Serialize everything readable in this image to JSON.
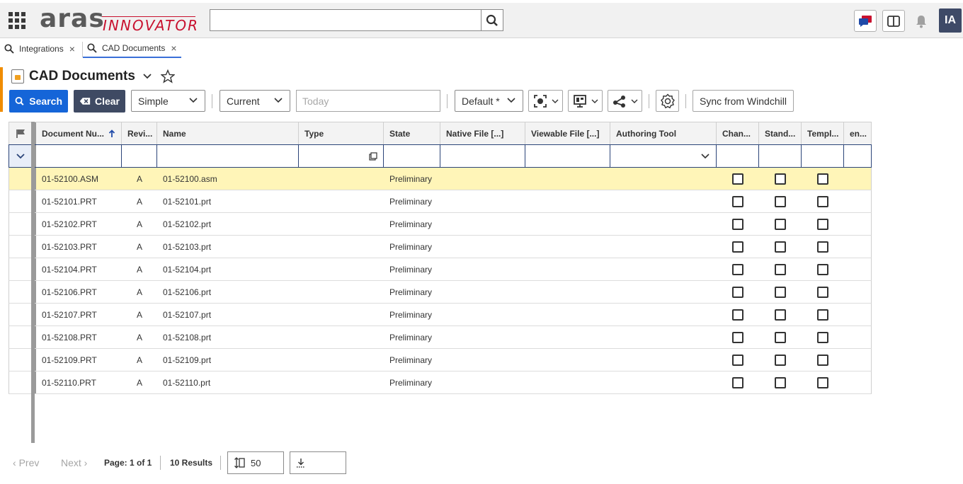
{
  "header": {
    "logo_main": "aras",
    "logo_sub": "INNOVATOR",
    "search_placeholder": "",
    "avatar_initials": "IA"
  },
  "tabs": [
    {
      "label": "Integrations",
      "active": false
    },
    {
      "label": "CAD Documents",
      "active": true
    }
  ],
  "page": {
    "title": "CAD Documents"
  },
  "toolbar": {
    "search_label": "Search",
    "clear_label": "Clear",
    "mode_select": "Simple",
    "version_select": "Current",
    "date_placeholder": "Today",
    "view_select": "Default *",
    "sync_label": "Sync from Windchill"
  },
  "grid": {
    "columns": [
      "Document Nu...",
      "Revi...",
      "Name",
      "Type",
      "State",
      "Native File [...]",
      "Viewable File [...]",
      "Authoring Tool",
      "Chan...",
      "Stand...",
      "Templ...",
      "en..."
    ],
    "rows": [
      {
        "doc": "01-52100.ASM",
        "rev": "A",
        "name": "01-52100.asm",
        "state": "Preliminary"
      },
      {
        "doc": "01-52101.PRT",
        "rev": "A",
        "name": "01-52101.prt",
        "state": "Preliminary"
      },
      {
        "doc": "01-52102.PRT",
        "rev": "A",
        "name": "01-52102.prt",
        "state": "Preliminary"
      },
      {
        "doc": "01-52103.PRT",
        "rev": "A",
        "name": "01-52103.prt",
        "state": "Preliminary"
      },
      {
        "doc": "01-52104.PRT",
        "rev": "A",
        "name": "01-52104.prt",
        "state": "Preliminary"
      },
      {
        "doc": "01-52106.PRT",
        "rev": "A",
        "name": "01-52106.prt",
        "state": "Preliminary"
      },
      {
        "doc": "01-52107.PRT",
        "rev": "A",
        "name": "01-52107.prt",
        "state": "Preliminary"
      },
      {
        "doc": "01-52108.PRT",
        "rev": "A",
        "name": "01-52108.prt",
        "state": "Preliminary"
      },
      {
        "doc": "01-52109.PRT",
        "rev": "A",
        "name": "01-52109.prt",
        "state": "Preliminary"
      },
      {
        "doc": "01-52110.PRT",
        "rev": "A",
        "name": "01-52110.prt",
        "state": "Preliminary"
      }
    ]
  },
  "pager": {
    "prev": "Prev",
    "next": "Next",
    "page_info": "Page: 1 of 1",
    "results": "10 Results",
    "page_size": "50"
  },
  "colors": {
    "primary": "#1565d8",
    "clear_btn": "#3f4a63",
    "selected_row": "#fff5b8",
    "accent": "#f08c00",
    "logo_red": "#c8102e"
  }
}
